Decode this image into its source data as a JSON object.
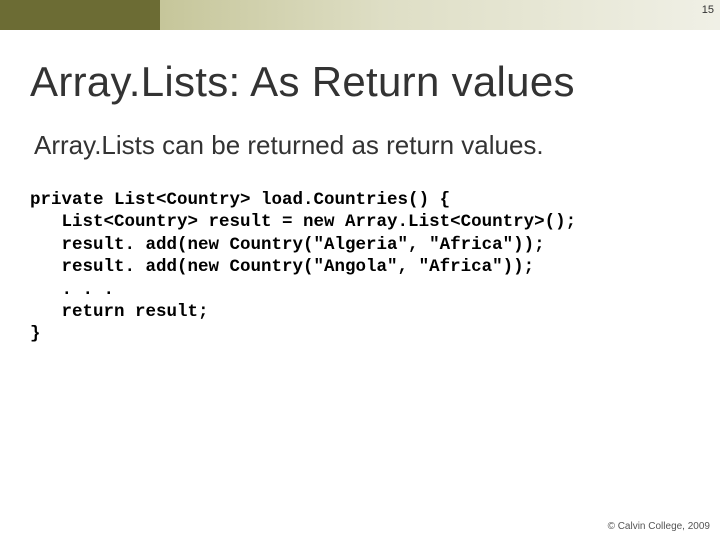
{
  "slide_number": "15",
  "title": "Array.Lists: As Return values",
  "subtitle": "Array.Lists can be returned as return values.",
  "code": {
    "l1": "private List<Country> load.Countries() {",
    "l2": "   List<Country> result = new Array.List<Country>();",
    "l3": "   result. add(new Country(\"Algeria\", \"Africa\"));",
    "l4": "   result. add(new Country(\"Angola\", \"Africa\"));",
    "l5": "   . . .",
    "l6": "   return result;",
    "l7": "}"
  },
  "footer": "© Calvin College, 2009"
}
